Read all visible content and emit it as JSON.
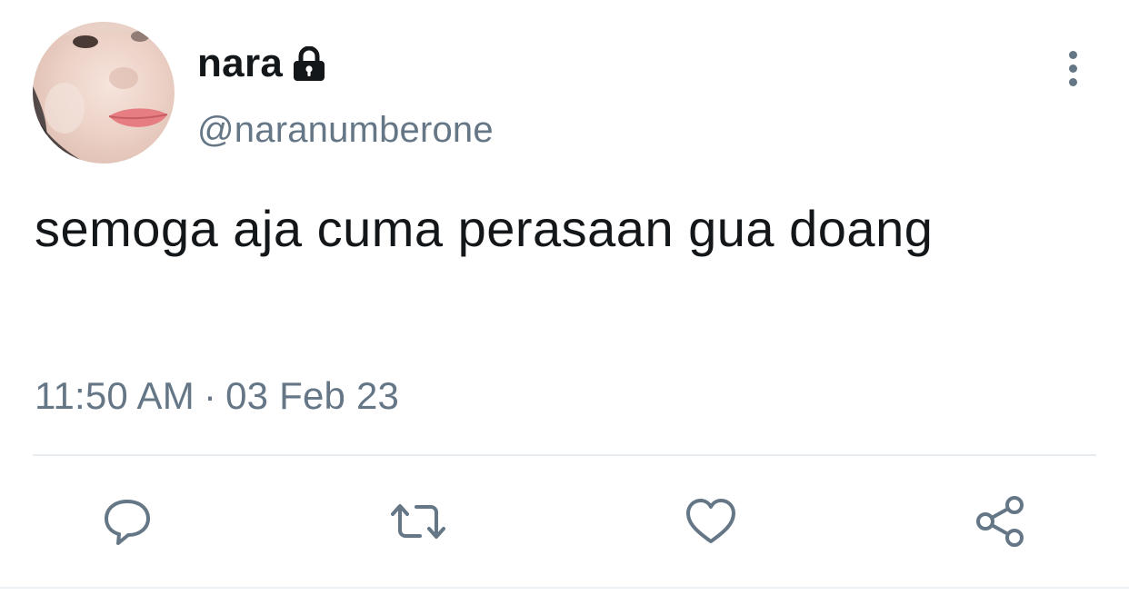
{
  "user": {
    "display_name": "nara",
    "handle": "@naranumberone",
    "protected_icon": "lock-icon",
    "avatar": "avatar-photo"
  },
  "tweet": {
    "text": "semoga aja cuma perasaan gua doang",
    "time": "11:50 AM",
    "separator": "·",
    "date": "03 Feb 23"
  },
  "actions": {
    "reply_icon": "reply-icon",
    "retweet_icon": "retweet-icon",
    "like_icon": "like-icon",
    "share_icon": "share-icon",
    "more_icon": "more-vertical-icon"
  },
  "colors": {
    "text": "#14171a",
    "secondary": "#657786",
    "divider": "#e6ecf0"
  }
}
